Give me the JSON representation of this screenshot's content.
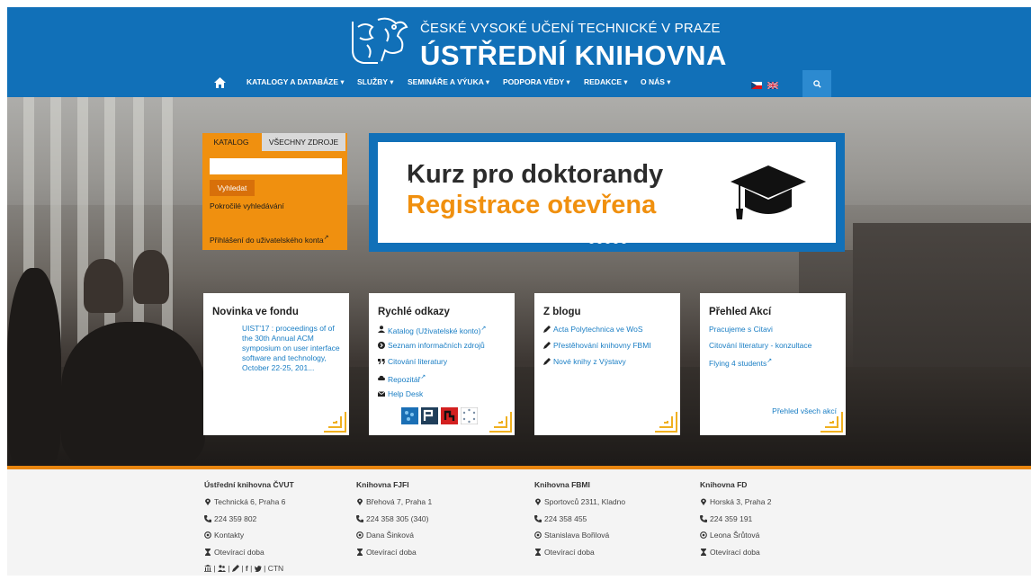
{
  "header": {
    "university_name": "ČESKÉ VYSOKÉ UČENÍ TECHNICKÉ V PRAZE",
    "library_name": "ÚSTŘEDNÍ KNIHOVNA",
    "home_icon": "home-icon",
    "logo_icon": "cvut-lion-logo",
    "nav": {
      "katalogy": "KATALOGY A DATABÁZE ▾",
      "sluzby": "SLUŽBY ▾",
      "seminare": "SEMINÁŘE A VÝUKA ▾",
      "podpora": "PODPORA VĚDY ▾",
      "redakce": "REDAKCE ▾",
      "onas": "O NÁS ▾"
    },
    "search_icon": "search-icon",
    "colors": {
      "primary": "#1170b8",
      "accent": "#f0900f",
      "search_btn": "#2c8ad0"
    }
  },
  "search": {
    "tab_catalog": "KATALOG",
    "tab_all": "VŠECHNY ZDROJE",
    "input_value": "",
    "submit": "Vyhledat",
    "advanced": "Pokročilé vyhledávání",
    "login": "Přihlášení do uživatelského konta"
  },
  "banner": {
    "title": "Kurz pro doktorandy",
    "subtitle": "Registrace otevřena",
    "icon": "graduation-cap-icon",
    "slides_total": 5,
    "active_slide": 3
  },
  "cards": {
    "novinka": {
      "title": "Novinka ve fondu",
      "text": "UIST'17 : proceedings of of the 30th Annual ACM symposium on user interface software and technology, October 22-25, 201..."
    },
    "rychle": {
      "title": "Rychlé odkazy",
      "items": [
        {
          "icon": "user-icon",
          "label": "Katalog (Uživatelské konto)"
        },
        {
          "icon": "arrow-circle-icon",
          "label": "Seznam informačních zdrojů"
        },
        {
          "icon": "quote-icon",
          "label": "Citování literatury"
        },
        {
          "icon": "cloud-icon",
          "label": "Repozitář"
        },
        {
          "icon": "envelope-icon",
          "label": "Help Desk"
        }
      ]
    },
    "blog": {
      "title": "Z blogu",
      "items": [
        {
          "icon": "pencil-icon",
          "label": "Acta Polytechnica ve WoS"
        },
        {
          "icon": "pencil-icon",
          "label": "Přestěhování knihovny FBMI"
        },
        {
          "icon": "pencil-icon",
          "label": "Nové knihy z Výstavy"
        }
      ]
    },
    "akce": {
      "title": "Přehled Akcí",
      "items": [
        "Pracujeme s Citavi",
        "Citování literatury - konzultace",
        "Flying 4 students"
      ],
      "all": "Přehled všech akcí"
    }
  },
  "footer": {
    "cols": [
      {
        "title": "Ústřední knihovna ČVUT",
        "address": "Technická 6, Praha 6",
        "phone": "224 359 802",
        "contact": "Kontakty",
        "hours": "Otevírací doba",
        "social": "CTN"
      },
      {
        "title": "Knihovna FJFI",
        "address": "Břehová 7, Praha 1",
        "phone": "224 358 305 (340)",
        "contact": "Dana Šinková",
        "hours": "Otevírací doba"
      },
      {
        "title": "Knihovna FBMI",
        "address": "Sportovců 2311, Kladno",
        "phone": "224 358 455",
        "contact": "Stanislava Bořilová",
        "hours": "Otevírací doba"
      },
      {
        "title": "Knihovna FD",
        "address": "Horská 3, Praha 2",
        "phone": "224 359 191",
        "contact": "Leona Šrůtová",
        "hours": "Otevírací doba"
      }
    ]
  }
}
